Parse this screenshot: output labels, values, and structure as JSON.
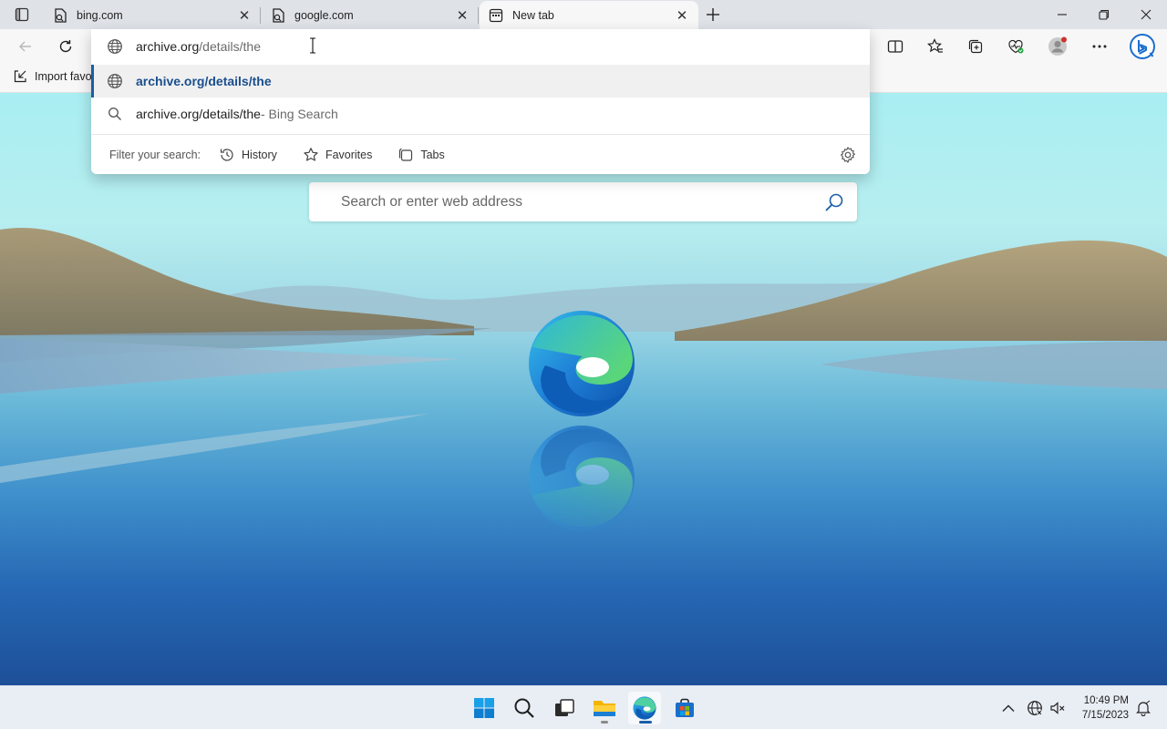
{
  "tabs": [
    {
      "title": "bing.com",
      "active": false
    },
    {
      "title": "google.com",
      "active": false
    },
    {
      "title": "New tab",
      "active": true
    }
  ],
  "addressbar": {
    "host": "archive.org",
    "path": "/details/the"
  },
  "suggestions": [
    {
      "label": "archive.org/details/the",
      "icon": "globe-icon"
    },
    {
      "label": "archive.org/details/the",
      "suffix": " - Bing Search",
      "icon": "search-icon"
    }
  ],
  "filter": {
    "label": "Filter your search:",
    "history": "History",
    "favorites": "Favorites",
    "tabs": "Tabs"
  },
  "favorites_bar": {
    "import_label": "Import favo"
  },
  "ntp": {
    "search_placeholder": "Search or enter web address"
  },
  "taskbar": {
    "apps": [
      "windows-start-icon",
      "search-icon",
      "task-view-icon",
      "file-explorer-icon",
      "edge-icon",
      "store-icon"
    ],
    "time": "10:49 PM",
    "date": "7/15/2023"
  },
  "colors": {
    "accent": "#1a5ea8",
    "tabstrip": "#dfe3e8",
    "toolbar": "#f7f7f7"
  }
}
